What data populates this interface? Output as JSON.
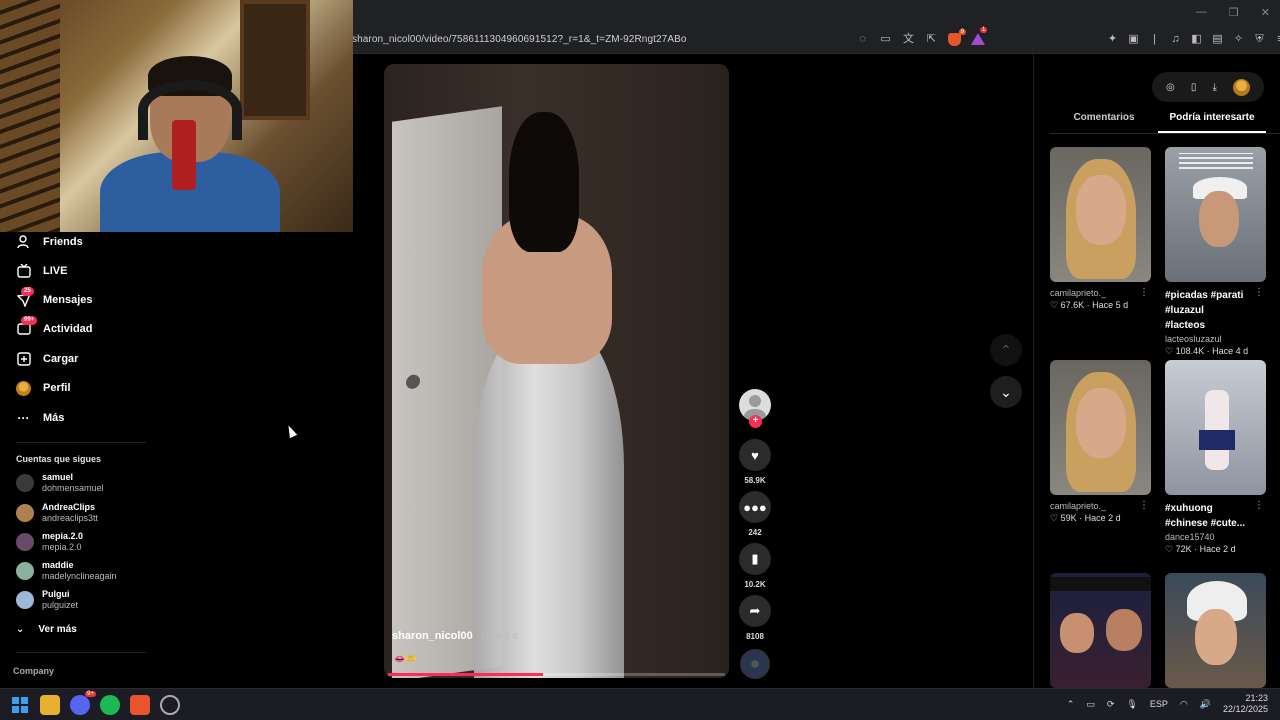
{
  "browser": {
    "url": "sharon_nicol00/video/7586111304960691512?_r=1&_t=ZM-92Rngt27ABo",
    "shield_badge": "9",
    "rewards_badge": "1"
  },
  "sidebar": {
    "items": [
      {
        "label": "Friends",
        "icon": "friends-icon"
      },
      {
        "label": "LIVE",
        "icon": "live-icon"
      },
      {
        "label": "Mensajes",
        "icon": "messages-icon",
        "badge": "25"
      },
      {
        "label": "Actividad",
        "icon": "activity-icon",
        "badge": "99+"
      },
      {
        "label": "Cargar",
        "icon": "upload-icon"
      },
      {
        "label": "Perfil",
        "icon": "profile-avatar"
      },
      {
        "label": "Más",
        "icon": "more-icon"
      }
    ],
    "following_title": "Cuentas que sigues",
    "following": [
      {
        "name": "samuel",
        "handle": "dohmensamuel"
      },
      {
        "name": "AndreaClips",
        "handle": "andreaclips3tt"
      },
      {
        "name": "mepia.2.0",
        "handle": "mepia.2.0"
      },
      {
        "name": "maddie",
        "handle": "madelynclineagain"
      },
      {
        "name": "Pulgui",
        "handle": "pulguizet"
      }
    ],
    "see_more": "Ver más",
    "company": "Company"
  },
  "video": {
    "author": "sharon_nicol00",
    "time": "Hace 1 d",
    "emoji": "👄🫶",
    "progress": 0.46
  },
  "actions": {
    "likes": "58.9K",
    "comments": "242",
    "saves": "10.2K",
    "shares": "8108"
  },
  "right_panel": {
    "tabs": [
      "Comentarios",
      "Podría interesarte"
    ],
    "active_tab": 1,
    "cards": [
      {
        "title": "",
        "user": "camilaprieto._",
        "likes": "67.6K",
        "time": "Hace 5 d"
      },
      {
        "title": "#picadas #parati #luzazul #lacteos",
        "user": "lacteosluzazul",
        "likes": "108.4K",
        "time": "Hace 4 d"
      },
      {
        "title": "",
        "user": "camilaprieto._",
        "likes": "59K",
        "time": "Hace 2 d"
      },
      {
        "title": "#xuhuong #chinese #cute...",
        "user": "dance15740",
        "likes": "72K",
        "time": "Hace 2 d"
      }
    ]
  },
  "taskbar": {
    "discord_badge": "9+",
    "lang": "ESP",
    "time": "21:23",
    "date": "22/12/2025"
  },
  "colors": {
    "accent": "#fe2c55",
    "panel_bg": "#000000",
    "taskbar_bg": "#1c1c24"
  }
}
